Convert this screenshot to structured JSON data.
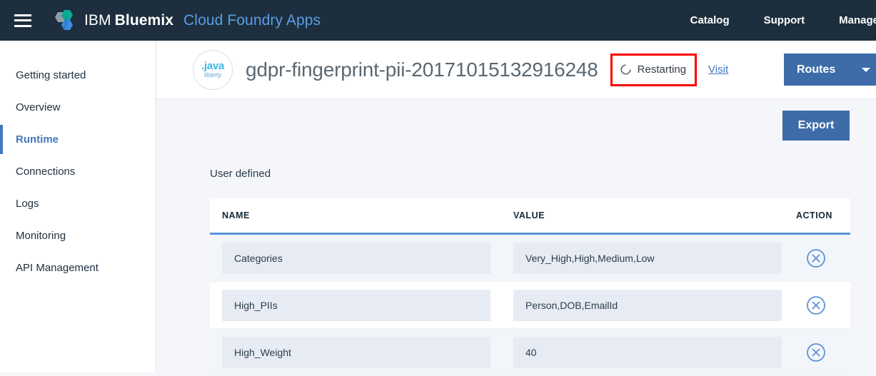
{
  "topnav": {
    "menu_icon": "hamburger-menu-icon",
    "logo_icon": "bluemix-logo-icon",
    "brand_ibm": "IBM",
    "brand_bluemix": "Bluemix",
    "brand_product": "Cloud Foundry Apps",
    "background_color": "#1d2f3e",
    "links": [
      {
        "label": "Catalog"
      },
      {
        "label": "Support"
      },
      {
        "label": "Manage"
      }
    ]
  },
  "sidebar": {
    "items": [
      {
        "label": "Getting started",
        "active": false
      },
      {
        "label": "Overview",
        "active": false
      },
      {
        "label": "Runtime",
        "active": true
      },
      {
        "label": "Connections",
        "active": false
      },
      {
        "label": "Logs",
        "active": false
      },
      {
        "label": "Monitoring",
        "active": false
      },
      {
        "label": "API Management",
        "active": false
      }
    ],
    "active_color": "#4178be"
  },
  "app_header": {
    "runtime_icon": "java-liberty-icon",
    "runtime_icon_top": ".java",
    "runtime_icon_bottom": "liberty",
    "app_name": "gdpr-fingerprint-pii-20171015132916248",
    "status": {
      "label": "Restarting",
      "icon": "spinner-icon",
      "highlight_color": "#fb0000",
      "highlighted": true
    },
    "visit_link": "Visit",
    "routes_button": "Routes",
    "routes_caret_icon": "chevron-down-icon",
    "button_color": "#3d6ca8"
  },
  "main": {
    "export_button": "Export",
    "section_label": "User defined",
    "table": {
      "columns": [
        "NAME",
        "VALUE",
        "ACTION"
      ],
      "header_underline_color": "#5b93d6",
      "delete_icon": "circle-x-icon",
      "rows": [
        {
          "name": "Categories",
          "value": "Very_High,High,Medium,Low"
        },
        {
          "name": "High_PIIs",
          "value": "Person,DOB,EmailId"
        },
        {
          "name": "High_Weight",
          "value": "40"
        }
      ]
    }
  }
}
